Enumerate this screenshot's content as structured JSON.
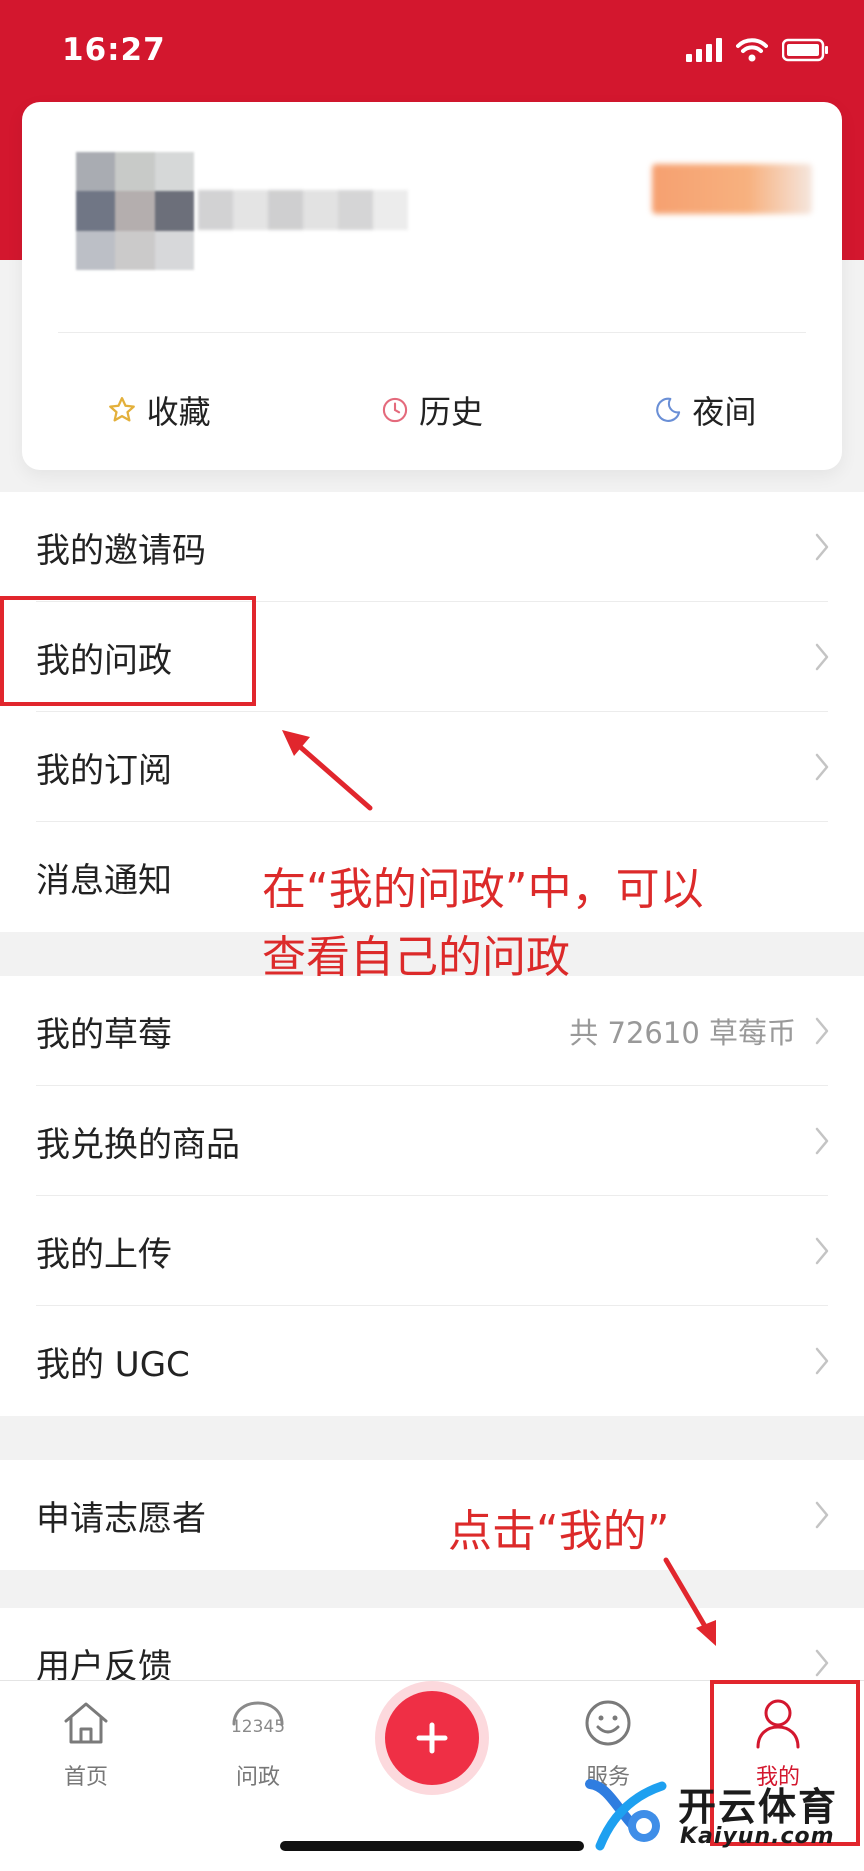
{
  "status_bar": {
    "time": "16:27"
  },
  "profile": {
    "quick_actions": [
      {
        "label": "收藏",
        "icon": "star-icon",
        "color": "#e3b03b"
      },
      {
        "label": "历史",
        "icon": "clock-icon",
        "color": "#e46a7c"
      },
      {
        "label": "夜间",
        "icon": "moon-icon",
        "color": "#6a8fd6"
      }
    ]
  },
  "menu": {
    "group1": [
      {
        "label": "我的邀请码"
      },
      {
        "label": "我的问政"
      },
      {
        "label": "我的订阅"
      },
      {
        "label": "消息通知"
      }
    ],
    "group2": [
      {
        "label": "我的草莓",
        "extra": "共 72610 草莓币"
      },
      {
        "label": "我兑换的商品"
      },
      {
        "label": "我的上传"
      },
      {
        "label": "我的 UGC"
      }
    ],
    "group3": [
      {
        "label": "申请志愿者"
      }
    ],
    "group4": [
      {
        "label": "用户反馈"
      }
    ]
  },
  "tabbar": {
    "tabs": [
      {
        "label": "首页",
        "icon": "home-icon"
      },
      {
        "label": "问政",
        "icon": "hotline-12345-icon",
        "icon_text": "12345"
      },
      {
        "label": "",
        "icon": "plus-icon"
      },
      {
        "label": "服务",
        "icon": "smiley-icon"
      },
      {
        "label": "我的",
        "icon": "person-icon"
      }
    ]
  },
  "annotations": {
    "note1_line1": "在“我的问政”中，可以",
    "note1_line2": "查看自己的问政",
    "note2": "点击“我的”",
    "color": "#dc2a2a"
  },
  "watermark": {
    "cn": "开云体育",
    "en": "Kaiyun.com"
  },
  "colors": {
    "brand_red": "#d3172e",
    "add_button": "#ef2f45"
  }
}
